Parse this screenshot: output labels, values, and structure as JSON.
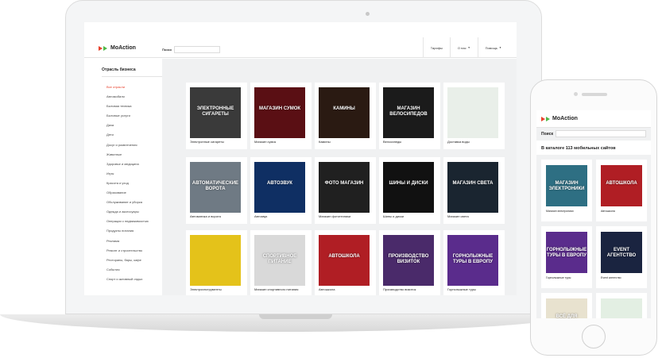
{
  "laptop": {
    "logo": "MoAction",
    "search_label": "Поиск",
    "nav": [
      {
        "label": "Тарифы"
      },
      {
        "label": "О нас"
      },
      {
        "label": "Помощь"
      }
    ],
    "sidebar": {
      "title": "Отрасль бизнеса",
      "items": [
        "Все отрасли",
        "Автомобили",
        "Бытовая техника",
        "Бытовые услуги",
        "Дача",
        "Дети",
        "Досуг и развлечения",
        "Животные",
        "Здоровье и медицина",
        "Игры",
        "Красота и уход",
        "Образование",
        "Обслуживание и уборка",
        "Одежда и аксессуары",
        "Операции с недвижимостью",
        "Продукты питания",
        "Реклама",
        "Ремонт и строительство",
        "Рестораны, бары, кафе",
        "События",
        "Спорт и активный отдых"
      ]
    },
    "cards": [
      {
        "caption": "Электронные сигареты",
        "tile": "ЭЛЕКТРОННЫЕ СИГАРЕТЫ",
        "color": "#3a3a3a"
      },
      {
        "caption": "Магазин сумок",
        "tile": "МАГАЗИН СУМОК",
        "color": "#5a0f14"
      },
      {
        "caption": "Камины",
        "tile": "КАМИНЫ",
        "color": "#2a1a12"
      },
      {
        "caption": "Велосипеды",
        "tile": "МАГАЗИН ВЕЛОСИПЕДОВ",
        "color": "#1b1b1b"
      },
      {
        "caption": "Доставка воды",
        "tile": "",
        "color": "#e9efe9"
      },
      {
        "caption": "Автоматика и ворота",
        "tile": "АВТОМАТИЧЕСКИЕ ВОРОТА",
        "color": "#6f7a84"
      },
      {
        "caption": "Автозвук",
        "tile": "АВТОЗВУК",
        "color": "#0f2f63"
      },
      {
        "caption": "Магазин фототехники",
        "tile": "ФОТО МАГАЗИН",
        "color": "#202020"
      },
      {
        "caption": "Шины и диски",
        "tile": "ШИНЫ И ДИСКИ",
        "color": "#111111"
      },
      {
        "caption": "Магазин света",
        "tile": "МАГАЗИН СВЕТА",
        "color": "#1a2530"
      },
      {
        "caption": "Электроинструменты",
        "tile": "",
        "color": "#e4c21a"
      },
      {
        "caption": "Магазин спортивного питания",
        "tile": "СПОРТИВНОЕ ПИТАНИЕ",
        "color": "#d9d9d9"
      },
      {
        "caption": "Автошкола",
        "tile": "АВТОШКОЛА",
        "color": "#b01e24"
      },
      {
        "caption": "Производство визиток",
        "tile": "ПРОИЗВОДСТВО ВИЗИТОК",
        "color": "#4a2a6a"
      },
      {
        "caption": "Горнолыжные туры",
        "tile": "ГОРНОЛЫЖНЫЕ ТУРЫ В ЕВРОПУ",
        "color": "#5a2c8c"
      }
    ]
  },
  "phone": {
    "logo": "MoAction",
    "search_label": "Поиск",
    "catalog_title": "В каталоге 113 мобильных сайтов",
    "cards": [
      {
        "caption": "Магазин электроники",
        "tile": "МАГАЗИН ЭЛЕКТРОНИКИ",
        "color": "#2e6f83"
      },
      {
        "caption": "Автошкола",
        "tile": "АВТОШКОЛА",
        "color": "#b01e24"
      },
      {
        "caption": "Горнолыжные туры",
        "tile": "ГОРНОЛЫЖНЫЕ ТУРЫ В ЕВРОПУ",
        "color": "#5a2c8c"
      },
      {
        "caption": "Event агентство",
        "tile": "EVENT АГЕНТСТВО",
        "color": "#1a2440"
      },
      {
        "caption": "",
        "tile": "ВСЁ ДЛЯ РЫБАЛКИ",
        "color": "#e8e2cf"
      },
      {
        "caption": "",
        "tile": "",
        "color": "#e3efe3"
      }
    ]
  }
}
